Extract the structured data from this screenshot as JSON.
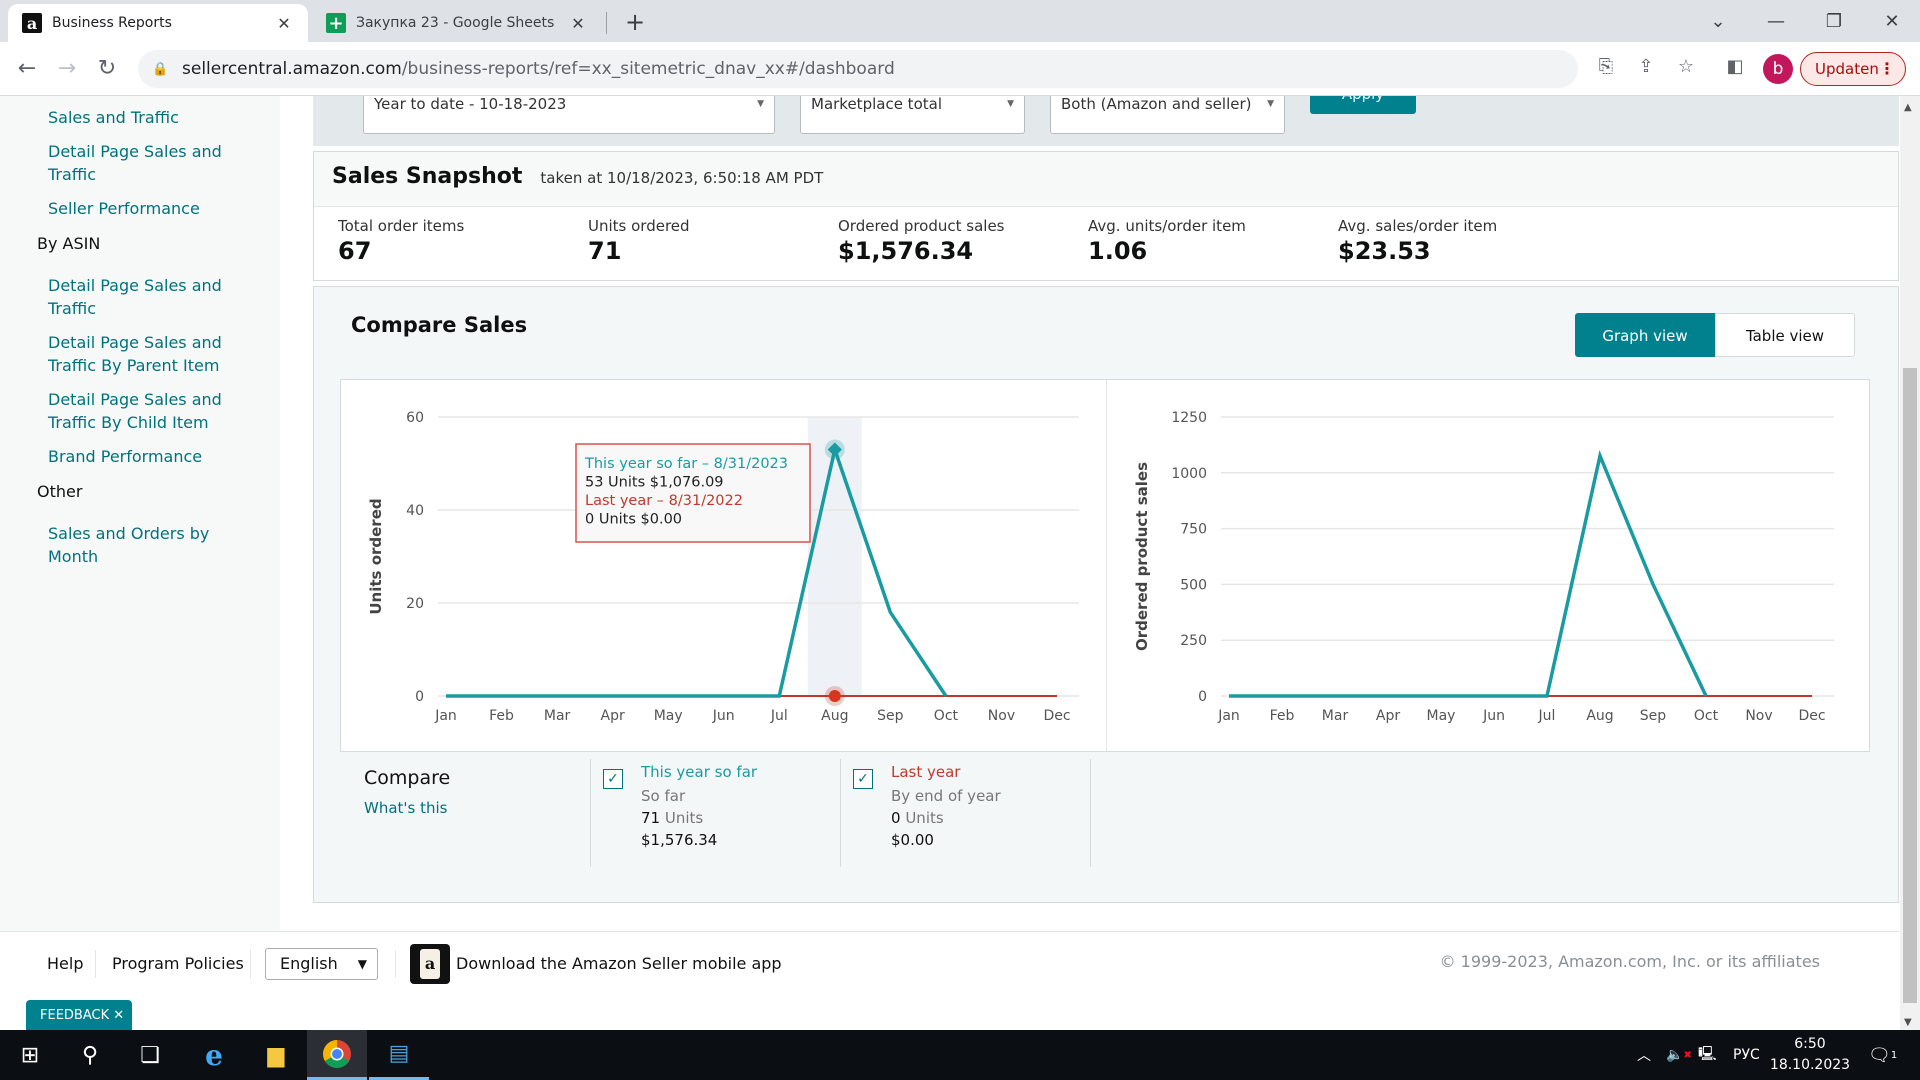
{
  "browser": {
    "tabs": [
      {
        "title": "Business Reports",
        "icon": "amazon-icon",
        "active": true
      },
      {
        "title": "Закупка 23 - Google Sheets",
        "icon": "google-sheets-icon",
        "active": false
      }
    ],
    "url_host": "sellercentral.amazon.com",
    "url_path": "/business-reports/ref=xx_sitemetric_dnav_xx#/dashboard",
    "profile_initial": "b",
    "update_label": "Updaten"
  },
  "sidebar": {
    "items": [
      {
        "type": "link",
        "label": "Sales and Traffic"
      },
      {
        "type": "link",
        "label": "Detail Page Sales and Traffic"
      },
      {
        "type": "link",
        "label": "Seller Performance"
      },
      {
        "type": "header",
        "label": "By ASIN"
      },
      {
        "type": "link",
        "label": "Detail Page Sales and Traffic"
      },
      {
        "type": "link",
        "label": "Detail Page Sales and Traffic By Parent Item"
      },
      {
        "type": "link",
        "label": "Detail Page Sales and Traffic By Child Item"
      },
      {
        "type": "link",
        "label": "Brand Performance"
      },
      {
        "type": "header",
        "label": "Other"
      },
      {
        "type": "link",
        "label": "Sales and Orders by Month"
      }
    ]
  },
  "filters": {
    "date_range": "Year to date - 10-18-2023",
    "marketplace": "Marketplace total",
    "fulfillment": "Both (Amazon and seller)",
    "apply_label": "Apply"
  },
  "snapshot": {
    "title": "Sales Snapshot",
    "taken_at": "taken at 10/18/2023, 6:50:18 AM PDT",
    "metrics": [
      {
        "label": "Total order items",
        "value": "67"
      },
      {
        "label": "Units ordered",
        "value": "71"
      },
      {
        "label": "Ordered product sales",
        "value": "$1,576.34"
      },
      {
        "label": "Avg. units/order item",
        "value": "1.06"
      },
      {
        "label": "Avg. sales/order item",
        "value": "$23.53"
      }
    ]
  },
  "compare": {
    "title": "Compare Sales",
    "graph_view_label": "Graph view",
    "table_view_label": "Table view",
    "active_view": "graph",
    "legend_title": "Compare",
    "whats_this": "What's this",
    "series": [
      {
        "name": "This year so far",
        "sub": "So far",
        "units": "71",
        "units_label": "Units",
        "sales": "$1,576.34",
        "checked": true,
        "color": "#1a9ba1"
      },
      {
        "name": "Last year",
        "sub": "By end of year",
        "units": "0",
        "units_label": "Units",
        "sales": "$0.00",
        "checked": true,
        "color": "#c0392b"
      }
    ],
    "tooltip": {
      "line1": "This year so far – 8/31/2023",
      "line2": "53 Units $1,076.09",
      "line3": "Last year – 8/31/2022",
      "line4": "0 Units $0.00"
    }
  },
  "chart_data": [
    {
      "type": "line",
      "title": "",
      "xlabel": "",
      "ylabel": "Units ordered",
      "categories": [
        "Jan",
        "Feb",
        "Mar",
        "Apr",
        "May",
        "Jun",
        "Jul",
        "Aug",
        "Sep",
        "Oct",
        "Nov",
        "Dec"
      ],
      "ylim": [
        0,
        60
      ],
      "yticks": [
        0,
        20,
        40,
        60
      ],
      "grid": true,
      "highlight_category": "Aug",
      "series": [
        {
          "name": "This year so far",
          "color": "#1a9ba1",
          "values": [
            0,
            0,
            0,
            0,
            0,
            0,
            0,
            53,
            18,
            0,
            null,
            null
          ]
        },
        {
          "name": "Last year",
          "color": "#c0392b",
          "values": [
            0,
            0,
            0,
            0,
            0,
            0,
            0,
            0,
            0,
            0,
            0,
            0
          ]
        }
      ]
    },
    {
      "type": "line",
      "title": "",
      "xlabel": "",
      "ylabel": "Ordered product sales",
      "categories": [
        "Jan",
        "Feb",
        "Mar",
        "Apr",
        "May",
        "Jun",
        "Jul",
        "Aug",
        "Sep",
        "Oct",
        "Nov",
        "Dec"
      ],
      "ylim": [
        0,
        1250
      ],
      "yticks": [
        0,
        250,
        500,
        750,
        1000,
        1250
      ],
      "grid": true,
      "series": [
        {
          "name": "This year so far",
          "color": "#1a9ba1",
          "values": [
            0,
            0,
            0,
            0,
            0,
            0,
            0,
            1076.09,
            500.25,
            0,
            null,
            null
          ]
        },
        {
          "name": "Last year",
          "color": "#c0392b",
          "values": [
            0,
            0,
            0,
            0,
            0,
            0,
            0,
            0,
            0,
            0,
            0,
            0
          ]
        }
      ]
    }
  ],
  "footer": {
    "help": "Help",
    "policies": "Program Policies",
    "language": "English",
    "app_promo": "Download the Amazon Seller mobile app",
    "copyright": "© 1999-2023, Amazon.com, Inc. or its affiliates",
    "feedback": "FEEDBACK ✕"
  },
  "taskbar": {
    "lang": "РУС",
    "time": "6:50",
    "date": "18.10.2023",
    "notifications": "1"
  }
}
